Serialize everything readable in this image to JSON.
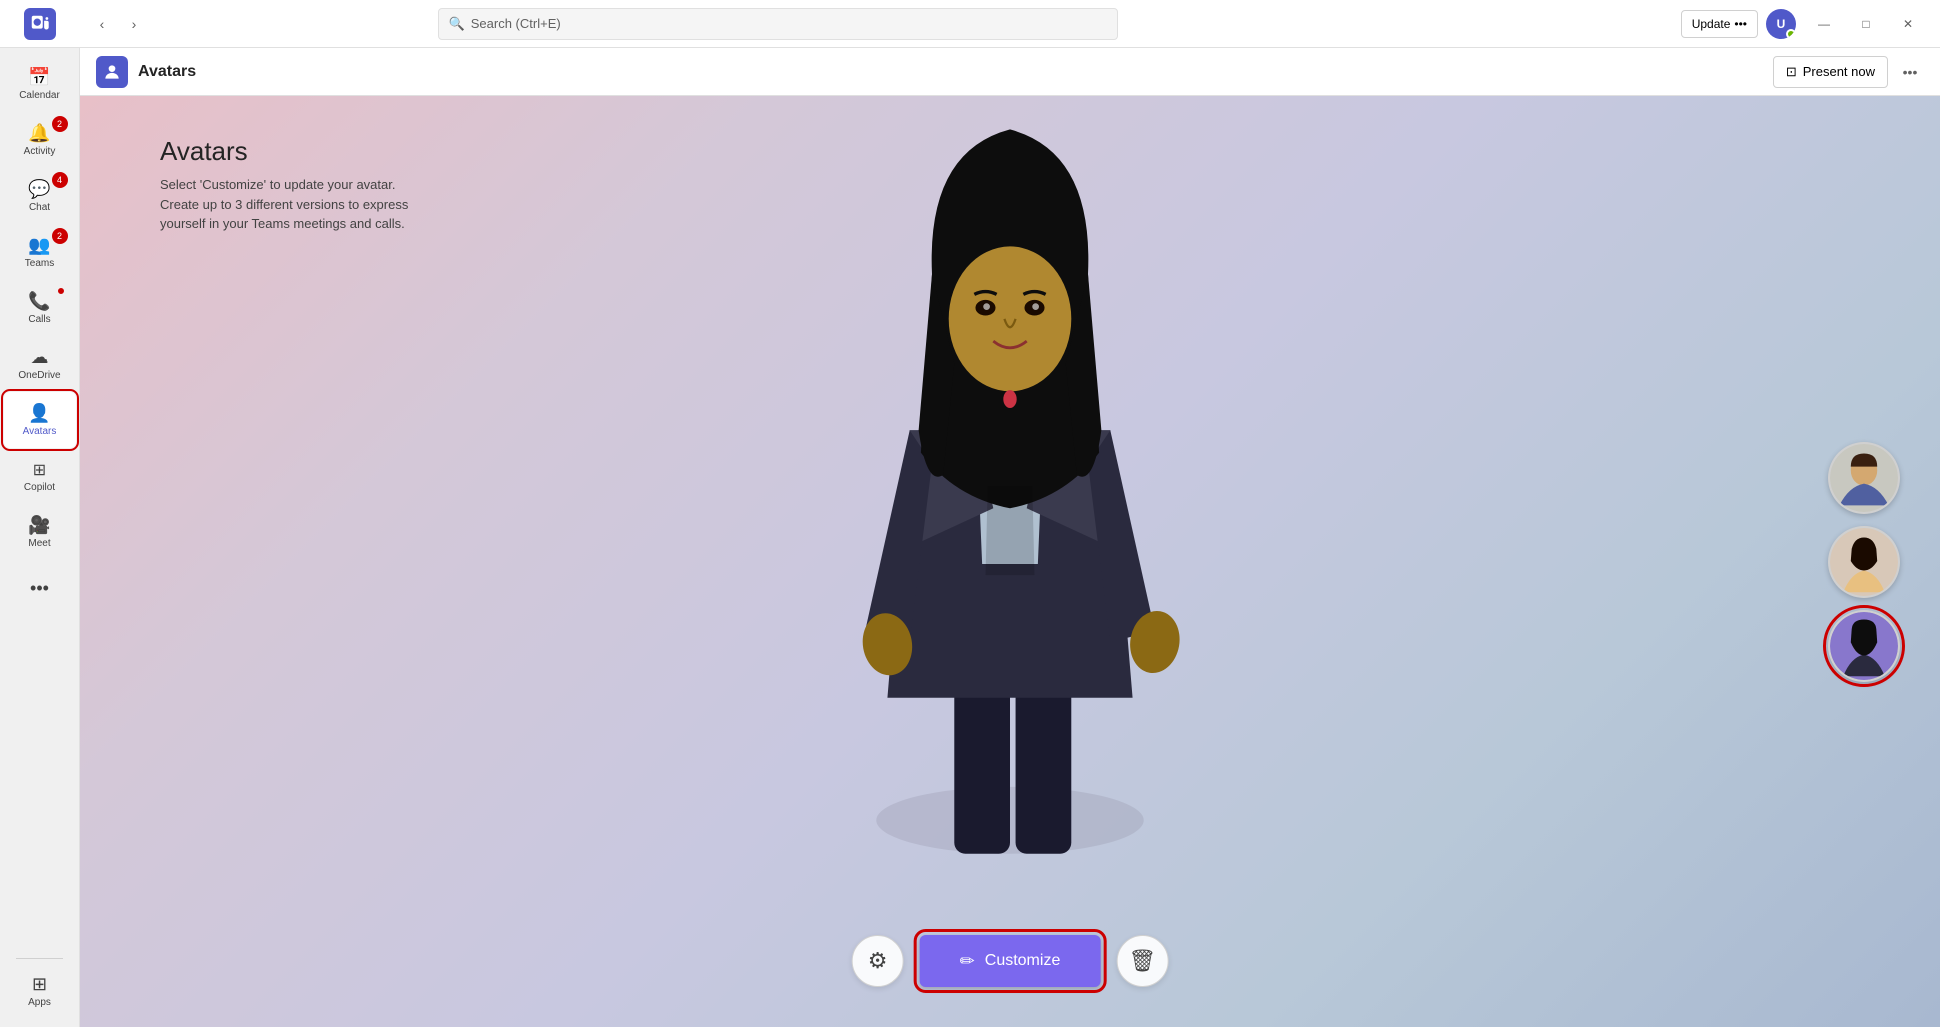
{
  "titlebar": {
    "search_placeholder": "Search (Ctrl+E)",
    "update_label": "Update",
    "update_dots": "•••",
    "minimize": "—",
    "maximize": "□",
    "close": "✕"
  },
  "nav": {
    "calendar_label": "Calendar",
    "activity_label": "Activity",
    "activity_badge": "2",
    "chat_label": "Chat",
    "chat_badge": "4",
    "teams_label": "Teams",
    "teams_badge": "2",
    "calls_label": "Calls",
    "onedrive_label": "OneDrive",
    "avatars_label": "Avatars",
    "copilot_label": "Copilot",
    "meet_label": "Meet",
    "more_label": "•••",
    "apps_label": "Apps"
  },
  "app_header": {
    "title": "Avatars",
    "present_label": "Present now",
    "more_dots": "•••"
  },
  "content": {
    "heading": "Avatars",
    "desc_line1": "Select 'Customize' to update your avatar.",
    "desc_line2": "Create up to 3 different versions to express",
    "desc_line3": "yourself in your Teams meetings and calls."
  },
  "controls": {
    "customize_label": "Customize",
    "pencil_icon": "✏",
    "trash_icon": "🗑",
    "settings_icon": "⚙"
  }
}
